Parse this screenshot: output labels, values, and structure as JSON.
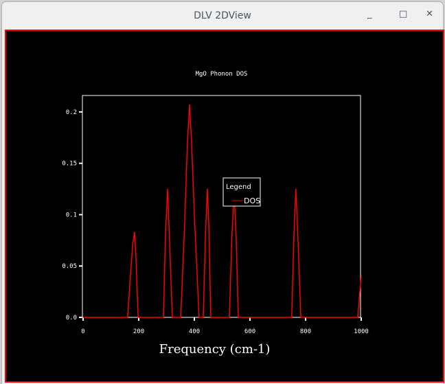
{
  "window": {
    "title": "DLV 2DView",
    "minimize": "_",
    "maximize": "□",
    "close": "✕"
  },
  "chart_data": {
    "type": "line",
    "title": "MgO Phonon DOS",
    "xlabel": "Frequency (cm-1)",
    "ylabel": "",
    "xlim": [
      0,
      1000
    ],
    "ylim": [
      0,
      0.208
    ],
    "xticks": [
      "0",
      "200",
      "400",
      "600",
      "800",
      "1000"
    ],
    "yticks": [
      "0.0",
      "0.05",
      "0.1",
      "0.15",
      "0.2"
    ],
    "legend": {
      "title": "Legend",
      "placement": "center-right",
      "entries": [
        "DOS"
      ]
    },
    "series": [
      {
        "name": "DOS",
        "color": "#ff0000",
        "x": [
          0,
          160,
          170,
          178,
          185,
          190,
          198,
          289,
          296,
          304,
          310,
          321,
          351,
          365,
          375,
          383,
          390,
          400,
          417,
          432,
          440,
          447,
          452,
          459,
          526,
          535,
          543,
          550,
          558,
          750,
          758,
          765,
          772,
          783,
          988,
          995,
          1000
        ],
        "y": [
          0,
          0,
          0.04,
          0.07,
          0.083,
          0.06,
          0,
          0,
          0.08,
          0.125,
          0.08,
          0,
          0,
          0.09,
          0.17,
          0.207,
          0.17,
          0.1,
          0,
          0,
          0.08,
          0.125,
          0.09,
          0,
          0,
          0.08,
          0.12,
          0.08,
          0,
          0,
          0.08,
          0.125,
          0.08,
          0,
          0,
          0.025,
          0.04
        ]
      }
    ]
  }
}
